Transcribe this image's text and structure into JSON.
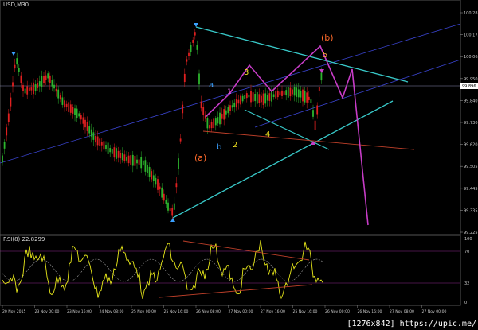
{
  "chart": {
    "symbol": "USD,M30",
    "indicator": "RSI(8) 22.8299",
    "watermark": "[1276x842] https://upic.me/"
  },
  "colors": {
    "background": "#000000",
    "bull_candle": "#2db52d",
    "bear_candle": "#e02020",
    "cyan_line": "#38c8c8",
    "blue_line": "#3a44d0",
    "magenta_wave": "#c73cc7",
    "red_line": "#c0402a",
    "rsi_line": "#e8e81a",
    "orange_label": "#ff6a2a",
    "yellow_label": "#f0e020",
    "blue_label": "#3aa0ff",
    "price_highlight": "#ffffff"
  },
  "wave_labels": {
    "a_paren": "(a)",
    "b_paren": "(b)",
    "a": "a",
    "b": "b",
    "w1": "1",
    "w2": "2",
    "w3": "3",
    "w4": "4",
    "w5": "5"
  },
  "chart_data": [
    {
      "type": "candlestick",
      "title": "USD,M30",
      "y_ticks": [
        "100.285",
        "100.175",
        "100.065",
        "99.950",
        "99.840",
        "99.730",
        "99.620",
        "99.505",
        "99.445",
        "99.335",
        "99.225"
      ],
      "current_price": "99.896",
      "x_ticks": [
        "20 Nov 2015",
        "23 Nov 00:00",
        "23 Nov 16:00",
        "24 Nov 08:00",
        "25 Nov 00:00",
        "25 Nov 16:00",
        "26 Nov 08:00",
        "27 Nov 00:00",
        "27 Nov 16:00",
        "25 Nov 16:00",
        "26 Nov 00:00",
        "26 Nov 16:00",
        "27 Nov 08:00",
        "27 Nov 00:00"
      ]
    },
    {
      "type": "line",
      "title": "RSI(8) 22.8299",
      "y_ticks": [
        "100",
        "70",
        "32",
        "0"
      ]
    }
  ]
}
